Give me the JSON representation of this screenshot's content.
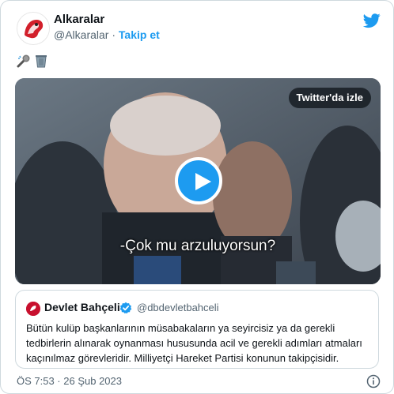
{
  "author": {
    "name": "Alkaralar",
    "handle": "@Alkaralar",
    "separator": "·",
    "follow_label": "Takip et"
  },
  "tweet_emojis": [
    "microphone-icon",
    "wastebasket-icon"
  ],
  "media": {
    "watch_label": "Twitter'da izle",
    "caption": "-Çok mu arzuluyorsun?"
  },
  "quoted": {
    "name": "Devlet Bahçeli",
    "handle": "@dbdevletbahceli",
    "text": "Bütün kulüp başkanlarının müsabakaların ya seyircisiz ya da gerekli tedbirlerin alınarak oynanması hususunda acil ve gerekli adımları atmaları kaçınılmaz görevleridir. Milliyetçi Hareket Partisi konunun takipçisidir."
  },
  "footer": {
    "timestamp": "ÖS 7:53 · 26 Şub 2023"
  },
  "colors": {
    "accent": "#1d9bf0",
    "text": "#0f1419",
    "muted": "#536471",
    "border": "#cfd9de"
  }
}
